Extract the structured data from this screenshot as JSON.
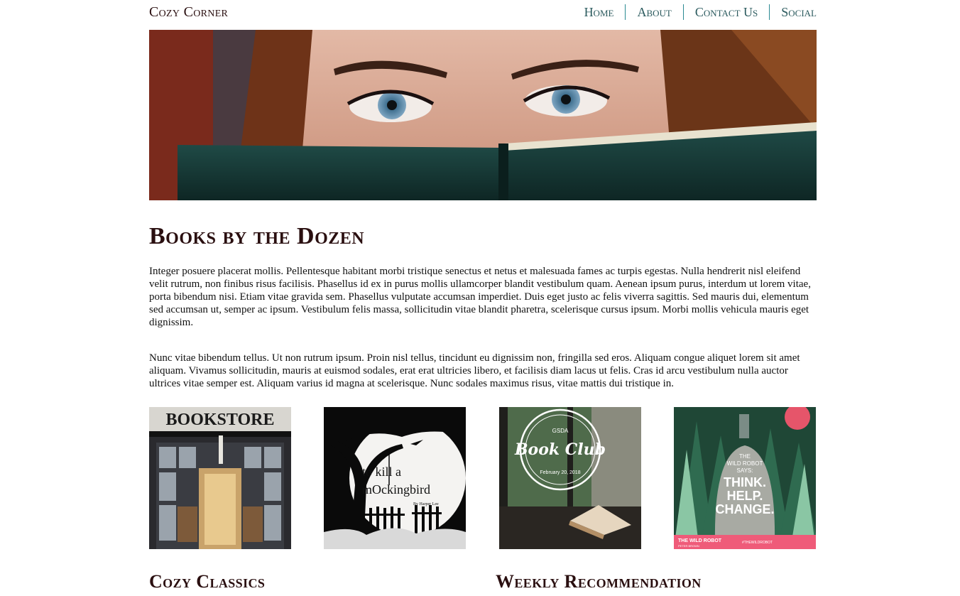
{
  "header": {
    "site_title": "Cozy Corner",
    "nav": [
      "Home",
      "About",
      "Contact Us",
      "Social"
    ]
  },
  "colors": {
    "nav_text": "#2b5a5e",
    "nav_divider": "#2a8a92",
    "title_text": "#2a0f10"
  },
  "hero": {
    "icon": "woman-reading-book-photo"
  },
  "main": {
    "title": "Books by the Dozen",
    "paragraphs": [
      "Integer posuere placerat mollis. Pellentesque habitant morbi tristique senectus et netus et malesuada fames ac turpis egestas. Nulla hendrerit nisl eleifend velit rutrum, non finibus risus facilisis. Phasellus id ex in purus mollis ullamcorper blandit vestibulum quam. Aenean ipsum purus, interdum ut lorem vitae, porta bibendum nisi. Etiam vitae gravida sem. Phasellus vulputate accumsan imperdiet. Duis eget justo ac felis viverra sagittis. Sed mauris dui, elementum sed accumsan ut, semper ac ipsum. Vestibulum felis massa, sollicitudin vitae blandit pharetra, scelerisque cursus ipsum. Morbi mollis vehicula mauris eget dignissim.",
      "Nunc vitae bibendum tellus. Ut non rutrum ipsum. Proin nisl tellus, tincidunt eu dignissim non, fringilla sed eros. Aliquam congue aliquet lorem sit amet aliquam. Vivamus sollicitudin, mauris at euismod sodales, erat erat ultricies libero, et facilisis diam lacus ut felis. Cras id arcu vestibulum nulla auctor ultrices vitae semper est. Aliquam varius id magna at scelerisque. Nunc sodales maximus risus, vitae mattis dui tristique in."
    ]
  },
  "thumbnails": {
    "bookstore": {
      "sign": "BOOKSTORE"
    },
    "mockingbird": {
      "line1": "to  kill a",
      "line2": "mOckingbird",
      "author": "By Harper Lee"
    },
    "book_club": {
      "org": "GSDA",
      "title": "Book Club",
      "date": "February 20, 2018"
    },
    "wild_robot": {
      "tagline": [
        "THE",
        "WILD ROBOT",
        "SAYS:",
        "THINK.",
        "HELP.",
        "CHANGE."
      ],
      "footer": "THE WILD ROBOT",
      "author": "PETER BROWN",
      "hashtag": "#THEWILDROBOT"
    }
  },
  "sections": {
    "left_title": "Cozy Classics",
    "right_title": "Weekly Recommendation"
  }
}
